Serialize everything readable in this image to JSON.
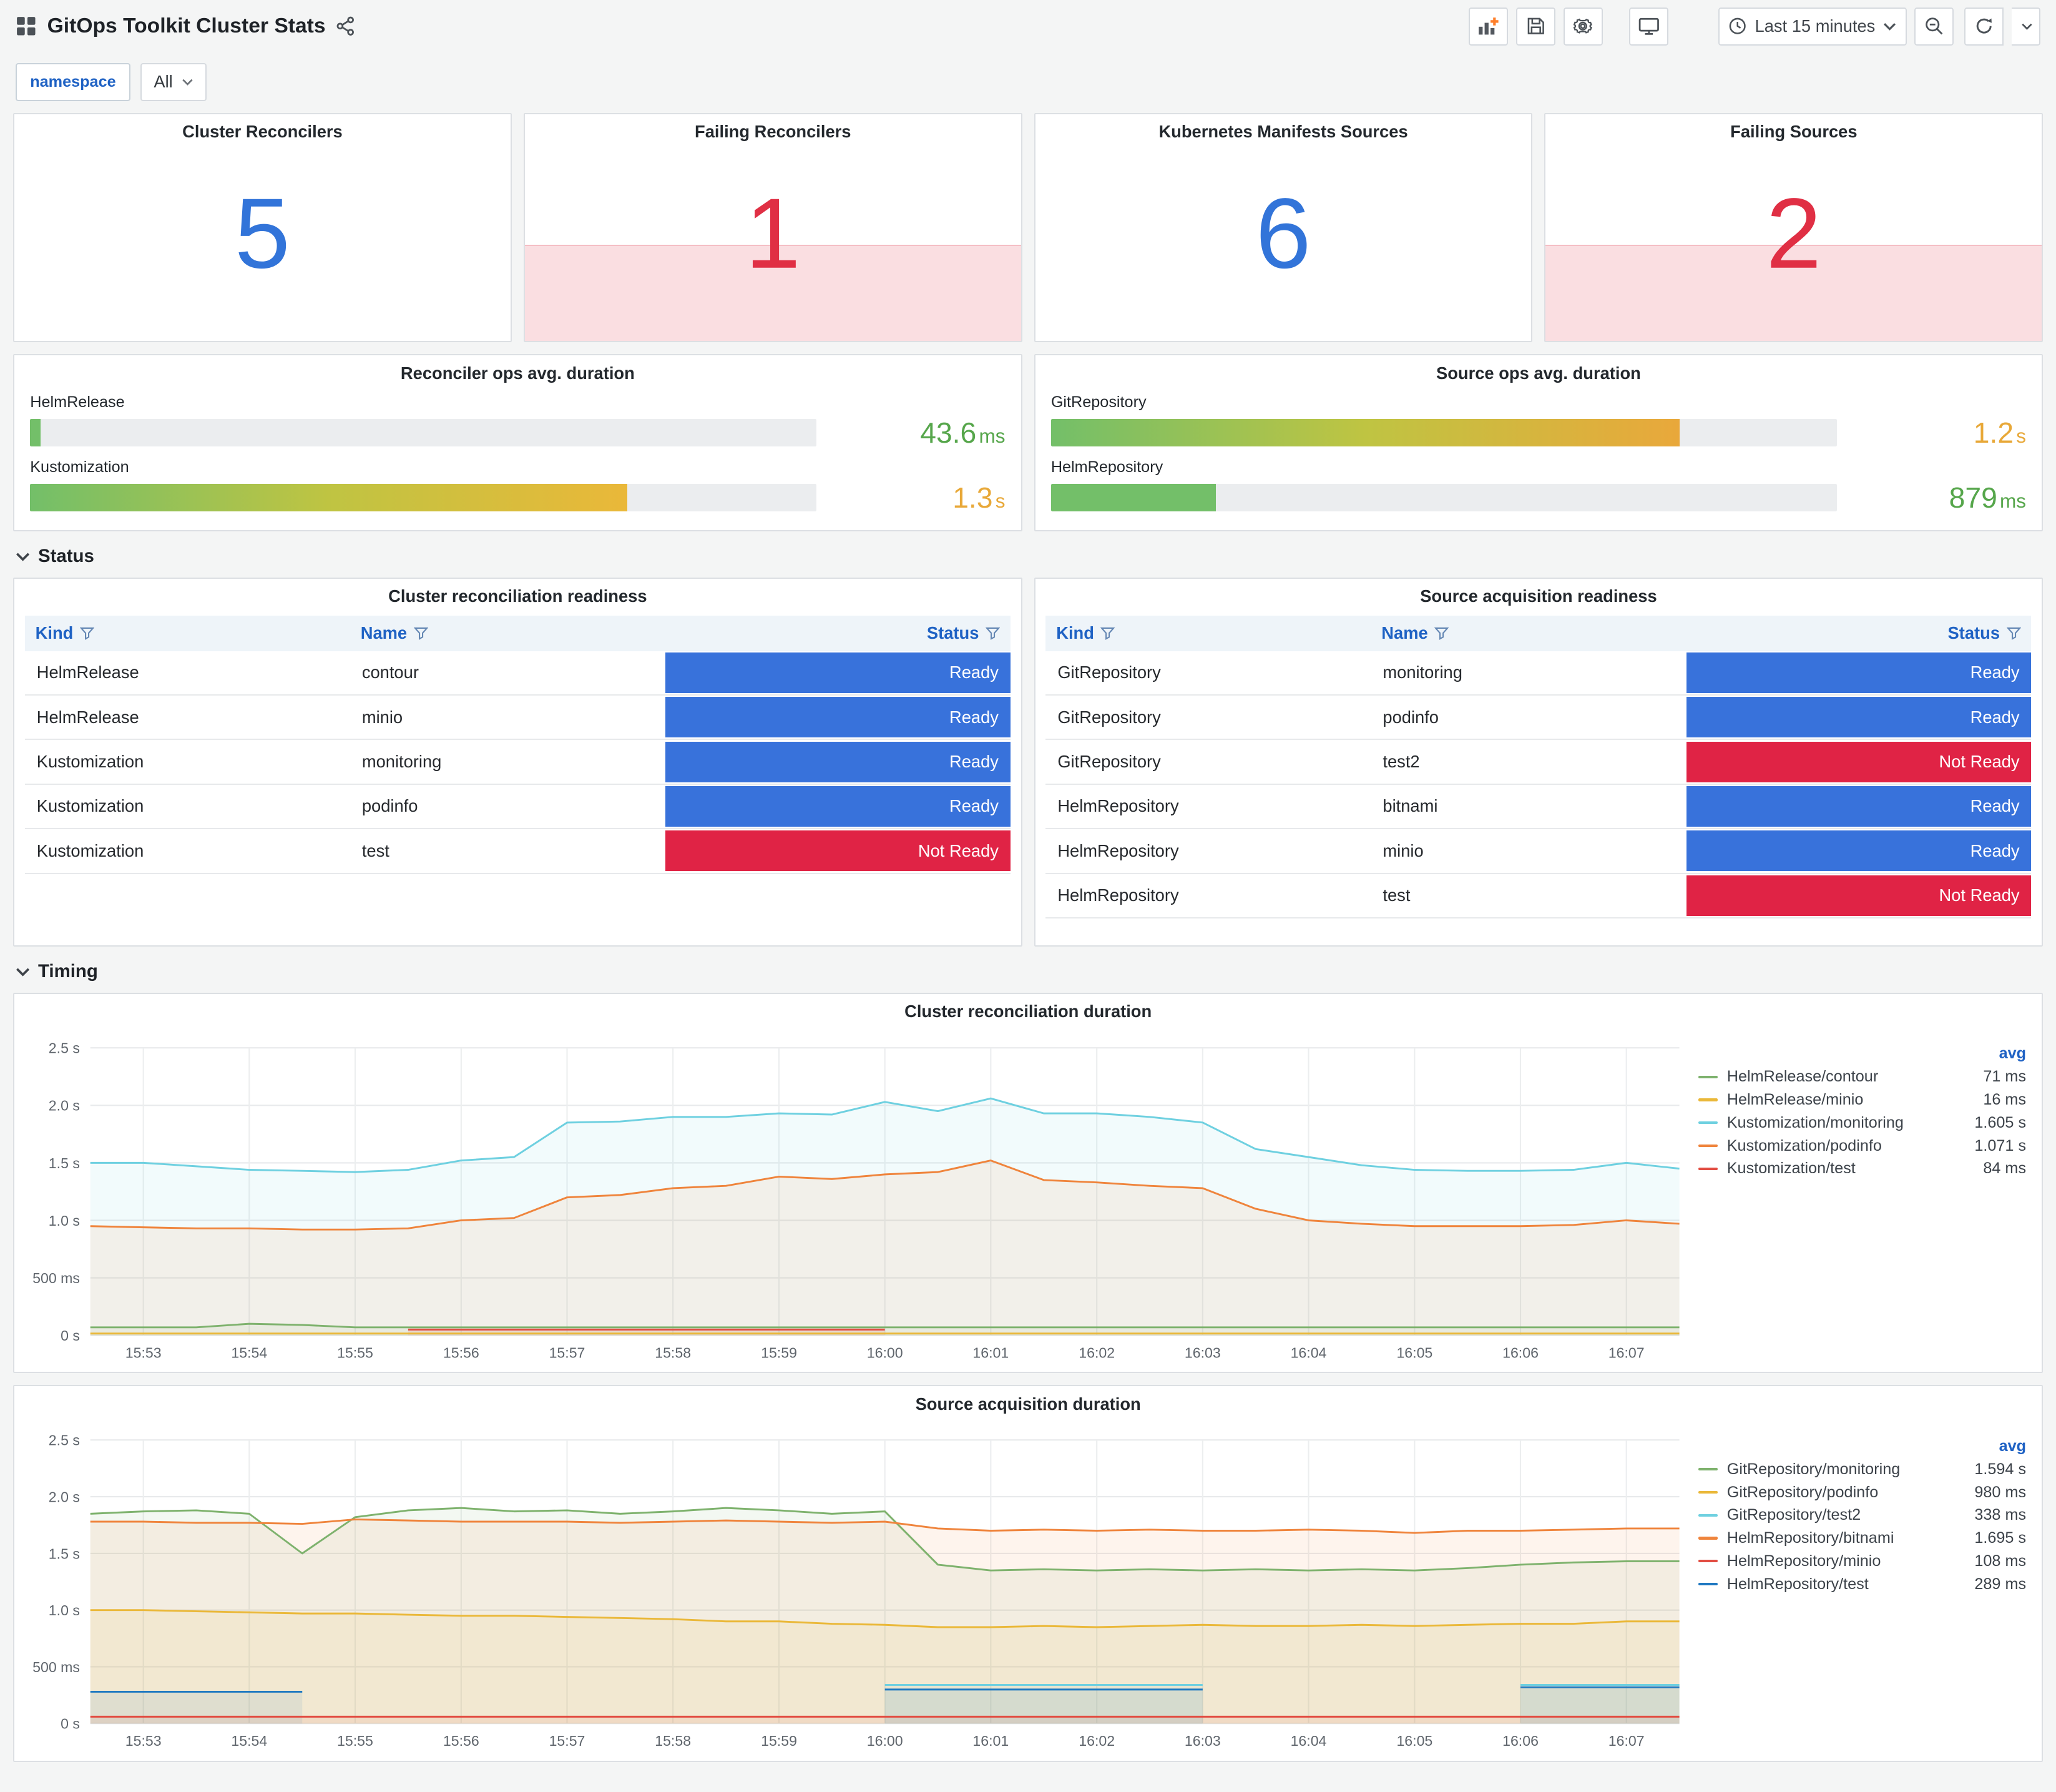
{
  "header": {
    "title": "GitOps Toolkit Cluster Stats"
  },
  "toolbar": {
    "time_range": "Last 15 minutes"
  },
  "variables": {
    "namespace_label": "namespace",
    "namespace_value": "All"
  },
  "sections": {
    "status": "Status",
    "timing": "Timing"
  },
  "stats": [
    {
      "title": "Cluster Reconcilers",
      "value": "5",
      "color": "#3274D9",
      "failing": false
    },
    {
      "title": "Failing Reconcilers",
      "value": "1",
      "color": "#E02F44",
      "failing": true
    },
    {
      "title": "Kubernetes Manifests Sources",
      "value": "6",
      "color": "#3274D9",
      "failing": false
    },
    {
      "title": "Failing Sources",
      "value": "2",
      "color": "#E02F44",
      "failing": true
    }
  ],
  "gauges": [
    {
      "title": "Reconciler ops avg. duration",
      "rows": [
        {
          "label": "HelmRelease",
          "value": "43.6",
          "unit": "ms",
          "pct": 1.3,
          "value_color": "#56A64B",
          "bar_colors": [
            "#73BF69"
          ]
        },
        {
          "label": "Kustomization",
          "value": "1.3",
          "unit": "s",
          "pct": 76,
          "value_color": "#E8A838",
          "bar_colors": [
            "#73BF69",
            "#BFC442",
            "#EAB839"
          ]
        }
      ]
    },
    {
      "title": "Source ops avg. duration",
      "rows": [
        {
          "label": "GitRepository",
          "value": "1.2",
          "unit": "s",
          "pct": 80,
          "value_color": "#E8A838",
          "bar_colors": [
            "#73BF69",
            "#BFC442",
            "#E9A83B"
          ]
        },
        {
          "label": "HelmRepository",
          "value": "879",
          "unit": "ms",
          "pct": 21,
          "value_color": "#56A64B",
          "bar_colors": [
            "#73BF69"
          ]
        }
      ]
    }
  ],
  "tables": [
    {
      "title": "Cluster reconciliation readiness",
      "columns": [
        "Kind",
        "Name",
        "Status"
      ],
      "rows": [
        [
          "HelmRelease",
          "contour",
          "Ready"
        ],
        [
          "HelmRelease",
          "minio",
          "Ready"
        ],
        [
          "Kustomization",
          "monitoring",
          "Ready"
        ],
        [
          "Kustomization",
          "podinfo",
          "Ready"
        ],
        [
          "Kustomization",
          "test",
          "Not Ready"
        ]
      ]
    },
    {
      "title": "Source acquisition readiness",
      "columns": [
        "Kind",
        "Name",
        "Status"
      ],
      "rows": [
        [
          "GitRepository",
          "monitoring",
          "Ready"
        ],
        [
          "GitRepository",
          "podinfo",
          "Ready"
        ],
        [
          "GitRepository",
          "test2",
          "Not Ready"
        ],
        [
          "HelmRepository",
          "bitnami",
          "Ready"
        ],
        [
          "HelmRepository",
          "minio",
          "Ready"
        ],
        [
          "HelmRepository",
          "test",
          "Not Ready"
        ]
      ]
    }
  ],
  "status_colors": {
    "Ready": "#3872DB",
    "Not Ready": "#E02345"
  },
  "chart_data": [
    {
      "type": "line",
      "title": "Cluster reconciliation duration",
      "ylabel_ticks": [
        "0 s",
        "500 ms",
        "1.0 s",
        "1.5 s",
        "2.0 s",
        "2.5 s"
      ],
      "yticks": [
        0,
        0.5,
        1.0,
        1.5,
        2.0,
        2.5
      ],
      "ylim": [
        0,
        2.5
      ],
      "x_range": [
        0,
        15
      ],
      "x_step": 0.5,
      "x_ticks": [
        0.5,
        1.5,
        2.5,
        3.5,
        4.5,
        5.5,
        6.5,
        7.5,
        8.5,
        9.5,
        10.5,
        11.5,
        12.5,
        13.5,
        14.5
      ],
      "x_tick_labels": [
        "15:53",
        "15:54",
        "15:55",
        "15:56",
        "15:57",
        "15:58",
        "15:59",
        "16:00",
        "16:01",
        "16:02",
        "16:03",
        "16:04",
        "16:05",
        "16:06",
        "16:07"
      ],
      "legend_header": "avg",
      "legend_position": "right",
      "grid": true,
      "series": [
        {
          "name": "HelmRelease/contour",
          "color": "#7EB26D",
          "avg": "71 ms",
          "values": [
            0.07,
            0.07,
            0.07,
            0.1,
            0.09,
            0.07,
            0.07,
            0.07,
            0.07,
            0.07,
            0.07,
            0.07,
            0.07,
            0.07,
            0.07,
            0.07,
            0.07,
            0.07,
            0.07,
            0.07,
            0.07,
            0.07,
            0.07,
            0.07,
            0.07,
            0.07,
            0.07,
            0.07,
            0.07,
            0.07,
            0.07
          ]
        },
        {
          "name": "HelmRelease/minio",
          "color": "#EAB839",
          "avg": "16 ms",
          "values": [
            0.016,
            0.016,
            0.016,
            0.016,
            0.016,
            0.016,
            0.016,
            0.016,
            0.016,
            0.016,
            0.016,
            0.016,
            0.016,
            0.016,
            0.016,
            0.016,
            0.016,
            0.016,
            0.016,
            0.016,
            0.016,
            0.016,
            0.016,
            0.016,
            0.016,
            0.016,
            0.016,
            0.016,
            0.016,
            0.016,
            0.016
          ]
        },
        {
          "name": "Kustomization/monitoring",
          "color": "#6ED0E0",
          "avg": "1.605 s",
          "values": [
            1.5,
            1.5,
            1.47,
            1.44,
            1.43,
            1.42,
            1.44,
            1.52,
            1.55,
            1.85,
            1.86,
            1.9,
            1.9,
            1.93,
            1.92,
            2.03,
            1.95,
            2.06,
            1.93,
            1.93,
            1.9,
            1.85,
            1.62,
            1.55,
            1.48,
            1.44,
            1.43,
            1.43,
            1.44,
            1.5,
            1.45
          ]
        },
        {
          "name": "Kustomization/podinfo",
          "color": "#EF843C",
          "avg": "1.071 s",
          "values": [
            0.95,
            0.94,
            0.93,
            0.93,
            0.92,
            0.92,
            0.93,
            1.0,
            1.02,
            1.2,
            1.22,
            1.28,
            1.3,
            1.38,
            1.36,
            1.4,
            1.42,
            1.52,
            1.35,
            1.33,
            1.3,
            1.28,
            1.1,
            1.0,
            0.97,
            0.95,
            0.95,
            0.95,
            0.96,
            1.0,
            0.97
          ]
        },
        {
          "name": "Kustomization/test",
          "color": "#E24D42",
          "avg": "84 ms",
          "values": [
            null,
            null,
            null,
            null,
            null,
            null,
            0.05,
            0.05,
            0.05,
            0.05,
            0.05,
            0.05,
            0.05,
            0.05,
            0.05,
            0.05,
            null,
            null,
            null,
            null,
            null,
            null,
            null,
            null,
            null,
            null,
            null,
            null,
            null,
            null,
            null
          ]
        }
      ]
    },
    {
      "type": "line",
      "title": "Source acquisition duration",
      "ylabel_ticks": [
        "0 s",
        "500 ms",
        "1.0 s",
        "1.5 s",
        "2.0 s",
        "2.5 s"
      ],
      "yticks": [
        0,
        0.5,
        1.0,
        1.5,
        2.0,
        2.5
      ],
      "ylim": [
        0,
        2.5
      ],
      "x_range": [
        0,
        15
      ],
      "x_step": 0.5,
      "x_ticks": [
        0.5,
        1.5,
        2.5,
        3.5,
        4.5,
        5.5,
        6.5,
        7.5,
        8.5,
        9.5,
        10.5,
        11.5,
        12.5,
        13.5,
        14.5
      ],
      "x_tick_labels": [
        "15:53",
        "15:54",
        "15:55",
        "15:56",
        "15:57",
        "15:58",
        "15:59",
        "16:00",
        "16:01",
        "16:02",
        "16:03",
        "16:04",
        "16:05",
        "16:06",
        "16:07"
      ],
      "legend_header": "avg",
      "legend_position": "right",
      "grid": true,
      "series": [
        {
          "name": "GitRepository/monitoring",
          "color": "#7EB26D",
          "avg": "1.594 s",
          "values": [
            1.85,
            1.87,
            1.88,
            1.85,
            1.5,
            1.82,
            1.88,
            1.9,
            1.87,
            1.88,
            1.85,
            1.87,
            1.9,
            1.88,
            1.85,
            1.87,
            1.4,
            1.35,
            1.36,
            1.35,
            1.36,
            1.35,
            1.36,
            1.35,
            1.36,
            1.35,
            1.37,
            1.4,
            1.42,
            1.43,
            1.43
          ]
        },
        {
          "name": "GitRepository/podinfo",
          "color": "#EAB839",
          "avg": "980 ms",
          "values": [
            1.0,
            1.0,
            0.99,
            0.98,
            0.97,
            0.97,
            0.96,
            0.95,
            0.95,
            0.94,
            0.93,
            0.92,
            0.9,
            0.9,
            0.88,
            0.87,
            0.85,
            0.85,
            0.86,
            0.85,
            0.86,
            0.87,
            0.86,
            0.86,
            0.87,
            0.86,
            0.87,
            0.88,
            0.88,
            0.9,
            0.9
          ]
        },
        {
          "name": "GitRepository/test2",
          "color": "#6ED0E0",
          "avg": "338 ms",
          "values": [
            null,
            null,
            null,
            null,
            null,
            null,
            null,
            null,
            null,
            null,
            null,
            null,
            null,
            null,
            null,
            0.34,
            0.34,
            0.34,
            0.34,
            0.34,
            0.34,
            0.34,
            null,
            null,
            null,
            null,
            null,
            0.34,
            0.34,
            0.34,
            0.34
          ]
        },
        {
          "name": "HelmRepository/bitnami",
          "color": "#EF843C",
          "avg": "1.695 s",
          "values": [
            1.78,
            1.78,
            1.77,
            1.77,
            1.76,
            1.8,
            1.79,
            1.78,
            1.78,
            1.78,
            1.77,
            1.78,
            1.79,
            1.78,
            1.77,
            1.78,
            1.72,
            1.7,
            1.71,
            1.7,
            1.71,
            1.7,
            1.7,
            1.71,
            1.7,
            1.68,
            1.7,
            1.7,
            1.71,
            1.72,
            1.72
          ]
        },
        {
          "name": "HelmRepository/minio",
          "color": "#E24D42",
          "avg": "108 ms",
          "values": [
            0.06,
            0.06,
            0.06,
            0.06,
            0.06,
            0.06,
            0.06,
            0.06,
            0.06,
            0.06,
            0.06,
            0.06,
            0.06,
            0.06,
            0.06,
            0.06,
            0.06,
            0.06,
            0.06,
            0.06,
            0.06,
            0.06,
            0.06,
            0.06,
            0.06,
            0.06,
            0.06,
            0.06,
            0.06,
            0.06,
            0.06
          ]
        },
        {
          "name": "HelmRepository/test",
          "color": "#1F78C1",
          "avg": "289 ms",
          "values": [
            0.28,
            0.28,
            0.28,
            0.28,
            0.28,
            null,
            null,
            null,
            null,
            null,
            null,
            null,
            null,
            null,
            null,
            0.3,
            0.3,
            0.3,
            0.3,
            0.3,
            0.3,
            0.3,
            null,
            null,
            null,
            null,
            null,
            0.32,
            0.32,
            0.32,
            0.32
          ]
        }
      ]
    }
  ]
}
